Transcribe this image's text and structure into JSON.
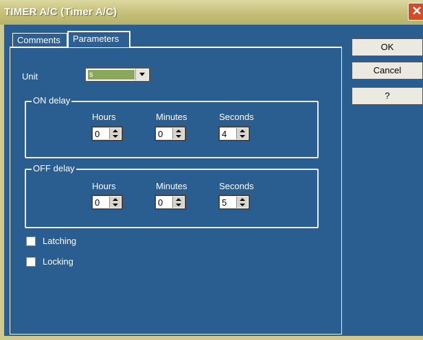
{
  "window": {
    "title": "TIMER A/C (Timer A/C)"
  },
  "tabs": [
    {
      "label": "Comments"
    },
    {
      "label": "Parameters"
    }
  ],
  "unit": {
    "label": "Unit",
    "value": "s"
  },
  "on_delay": {
    "legend": "ON delay",
    "hours_label": "Hours",
    "minutes_label": "Minutes",
    "seconds_label": "Seconds",
    "hours": "0",
    "minutes": "0",
    "seconds": "4"
  },
  "off_delay": {
    "legend": "OFF delay",
    "hours_label": "Hours",
    "minutes_label": "Minutes",
    "seconds_label": "Seconds",
    "hours": "0",
    "minutes": "0",
    "seconds": "5"
  },
  "options": {
    "latching": "Latching",
    "locking": "Locking"
  },
  "buttons": {
    "ok": "OK",
    "cancel": "Cancel",
    "help": "?"
  },
  "colors": {
    "background": "#2d5f91",
    "titlebar": "#c9c27e",
    "close": "#d64c24",
    "unit_highlight": "#8aa75a"
  }
}
